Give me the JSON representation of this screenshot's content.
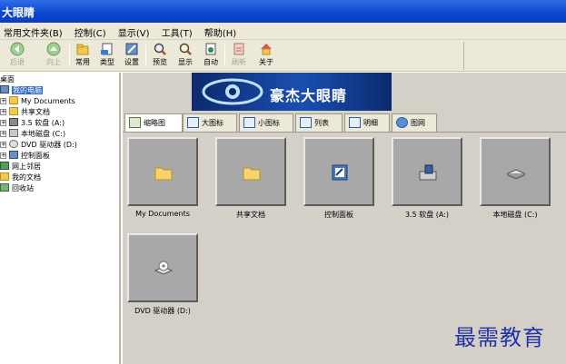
{
  "window": {
    "title": "大眼睛"
  },
  "menu": [
    {
      "label": "常用文件夹(B)"
    },
    {
      "label": "控制(C)"
    },
    {
      "label": "显示(V)"
    },
    {
      "label": "工具(T)"
    },
    {
      "label": "帮助(H)"
    }
  ],
  "toolbar": {
    "buttons": [
      {
        "label": "后退",
        "icon": "back-arrow-icon",
        "enabled": false
      },
      {
        "label": "向上",
        "icon": "up-arrow-icon",
        "enabled": false
      },
      {
        "label": "常用",
        "icon": "favorites-icon",
        "enabled": true
      },
      {
        "label": "类型",
        "icon": "file-type-icon",
        "enabled": true
      },
      {
        "label": "设置",
        "icon": "settings-icon",
        "enabled": true
      },
      {
        "label": "预览",
        "icon": "preview-icon",
        "enabled": true
      },
      {
        "label": "显示",
        "icon": "display-icon",
        "enabled": true
      },
      {
        "label": "自动",
        "icon": "auto-icon",
        "enabled": true
      },
      {
        "label": "刷新",
        "icon": "refresh-icon",
        "enabled": false
      },
      {
        "label": "关于",
        "icon": "about-icon",
        "enabled": true
      }
    ]
  },
  "tree": {
    "root": "桌面",
    "items": [
      {
        "label": "我的电脑",
        "icon": "computer-icon",
        "selected": true
      },
      {
        "label": "My Documents",
        "icon": "folder-icon"
      },
      {
        "label": "共享文档",
        "icon": "folder-icon"
      },
      {
        "label": "3.5 软盘 (A:)",
        "icon": "floppy-icon"
      },
      {
        "label": "本地磁盘 (C:)",
        "icon": "disk-icon"
      },
      {
        "label": "DVD 驱动器 (D:)",
        "icon": "dvd-icon"
      },
      {
        "label": "控制面板",
        "icon": "control-panel-icon"
      },
      {
        "label": "网上邻居",
        "icon": "network-icon"
      },
      {
        "label": "我的文档",
        "icon": "documents-icon"
      },
      {
        "label": "回收站",
        "icon": "recycle-bin-icon"
      }
    ]
  },
  "banner": {
    "text": "豪杰大眼睛"
  },
  "tabs": [
    {
      "label": "缩略图",
      "active": true
    },
    {
      "label": "大图标",
      "active": false
    },
    {
      "label": "小图标",
      "active": false
    },
    {
      "label": "列表",
      "active": false
    },
    {
      "label": "明细",
      "active": false
    },
    {
      "label": "图网",
      "active": false
    }
  ],
  "thumbnails": [
    {
      "label": "My Documents",
      "icon": "folder-icon"
    },
    {
      "label": "共享文档",
      "icon": "folder-icon"
    },
    {
      "label": "控制面板",
      "icon": "control-panel-icon"
    },
    {
      "label": "3.5 软盘 (A:)",
      "icon": "floppy-icon"
    },
    {
      "label": "本地磁盘 (C:)",
      "icon": "disk-icon"
    },
    {
      "label": "DVD 驱动器 (D:)",
      "icon": "dvd-icon"
    }
  ],
  "watermark": {
    "text": "最需教育"
  },
  "colors": {
    "titlebar": "#0a46d0",
    "chrome": "#ece9d8",
    "content": "#d4d0c8",
    "thumbnail": "#a8a8a8",
    "watermark": "#2233a8"
  }
}
